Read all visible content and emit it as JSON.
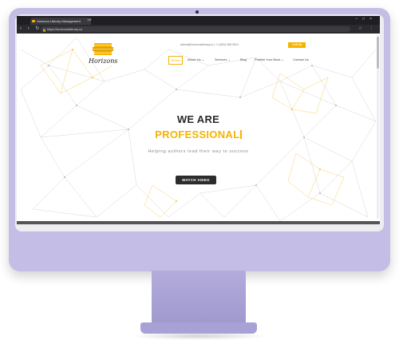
{
  "browser": {
    "tab_title": "Horizons Literary Management",
    "tab_close": "×",
    "new_tab": "+",
    "window_controls": "–□×",
    "nav_buttons": "‹ › ↻",
    "url": "https://horizonsliterary.co",
    "toolbar_icons": "☆ ⋮"
  },
  "site": {
    "logo_text": "Horizons",
    "contact": "admin@horizonsliterary.co | +1 (800) 368 0913",
    "login_label": "LOG IN",
    "nav": [
      {
        "label": "Home"
      },
      {
        "label": "About Us ⌄"
      },
      {
        "label": "Services ⌄"
      },
      {
        "label": "Blog"
      },
      {
        "label": "Publish Your Book ⌄"
      },
      {
        "label": "Contact Us"
      }
    ],
    "hero_line1": "WE ARE",
    "hero_line2": "PROFESSIONAL",
    "tagline": "Helping authors lead their way to success",
    "watch_button": "WATCH VIDEO"
  },
  "colors": {
    "accent": "#f5b400",
    "dark": "#2c2c2c",
    "monitor": "#c4bde6"
  }
}
